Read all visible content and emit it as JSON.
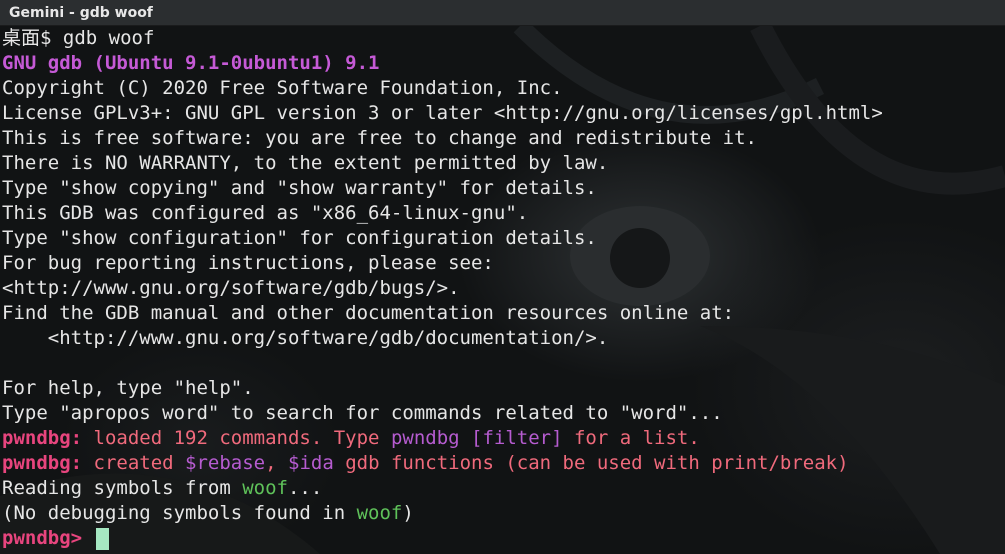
{
  "window": {
    "title": "Gemini - gdb woof"
  },
  "prompt": {
    "text": "桌面$ gdb woof"
  },
  "gdb_banner": "GNU gdb (Ubuntu 9.1-0ubuntu1) 9.1",
  "output_lines": [
    "Copyright (C) 2020 Free Software Foundation, Inc.",
    "License GPLv3+: GNU GPL version 3 or later <http://gnu.org/licenses/gpl.html>",
    "This is free software: you are free to change and redistribute it.",
    "There is NO WARRANTY, to the extent permitted by law.",
    "Type \"show copying\" and \"show warranty\" for details.",
    "This GDB was configured as \"x86_64-linux-gnu\".",
    "Type \"show configuration\" for configuration details.",
    "For bug reporting instructions, please see:",
    "<http://www.gnu.org/software/gdb/bugs/>.",
    "Find the GDB manual and other documentation resources online at:",
    "    <http://www.gnu.org/software/gdb/documentation/>.",
    "",
    "For help, type \"help\".",
    "Type \"apropos word\" to search for commands related to \"word\"..."
  ],
  "pwndbg_line1": {
    "tag": "pwndbg:",
    "pre": " loaded 192 commands. Type ",
    "cmd": "pwndbg [filter]",
    "post": " for a list."
  },
  "pwndbg_line2": {
    "tag": "pwndbg:",
    "pre": " created ",
    "rebase": "$rebase",
    "sep": ", ",
    "ida": "$ida",
    "post": " gdb functions (can be used with print/break)"
  },
  "reading_line": {
    "pre": "Reading symbols from ",
    "file": "woof",
    "post": "..."
  },
  "nodebug_line": {
    "pre": "(No debugging symbols found in ",
    "file": "woof",
    "post": ")"
  },
  "final_prompt": "pwndbg>",
  "colors": {
    "banner": "#c55ad6",
    "pwndbg_tag": "#e8457e",
    "pwndbg_text": "#f06a7c",
    "pwndbg_cmd": "#b65cd0",
    "filename": "#5fc25a",
    "cursor": "#a6e8c2"
  }
}
